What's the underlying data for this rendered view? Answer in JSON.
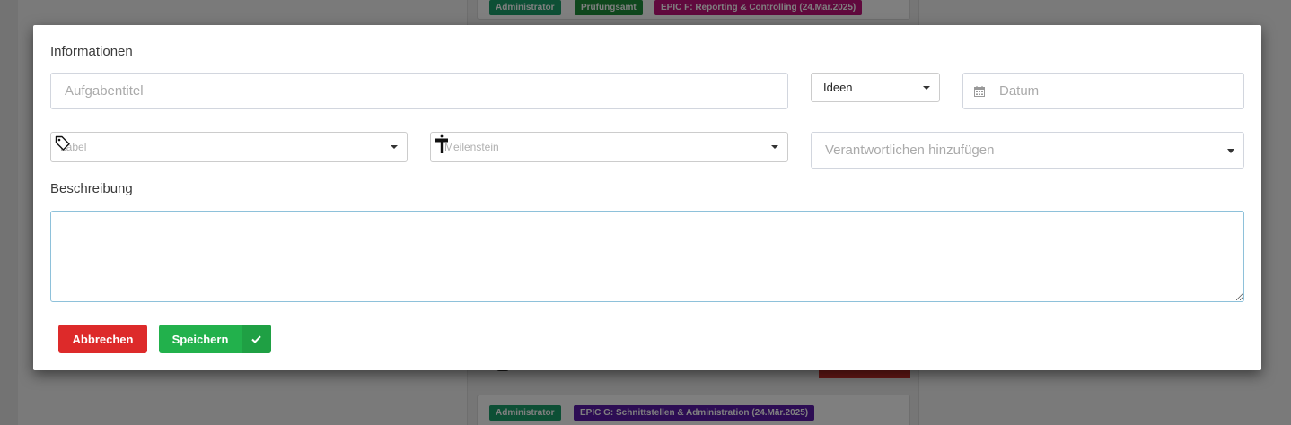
{
  "background": {
    "top_badges": [
      {
        "label": "Administrator",
        "color": "#1a9e6a"
      },
      {
        "label": "Prüfungsamt",
        "color": "#1e8f3a"
      },
      {
        "label": "EPIC F: Reporting & Controlling (24.Mär.2025)",
        "color": "#c0127a"
      }
    ],
    "bottom_badges": [
      {
        "label": "Administrator",
        "color": "#1a9e6a"
      },
      {
        "label": "EPIC G: Schnittstellen & Administration (24.Mär.2025)",
        "color": "#5a1aa8"
      }
    ]
  },
  "modal": {
    "section_info": "Informationen",
    "title_placeholder": "Aufgabentitel",
    "list_select": "Ideen",
    "date_placeholder": "Datum",
    "label_placeholder": "Label",
    "milestone_placeholder": "Meilenstein",
    "responsible_placeholder": "Verantwortlichen hinzufügen",
    "section_description": "Beschreibung",
    "description_value": "",
    "cancel_label": "Abbrechen",
    "save_label": "Speichern"
  },
  "icons": {
    "date": "calendar-icon",
    "label": "tag-icon",
    "milestone": "signpost-icon",
    "save": "check-icon"
  }
}
